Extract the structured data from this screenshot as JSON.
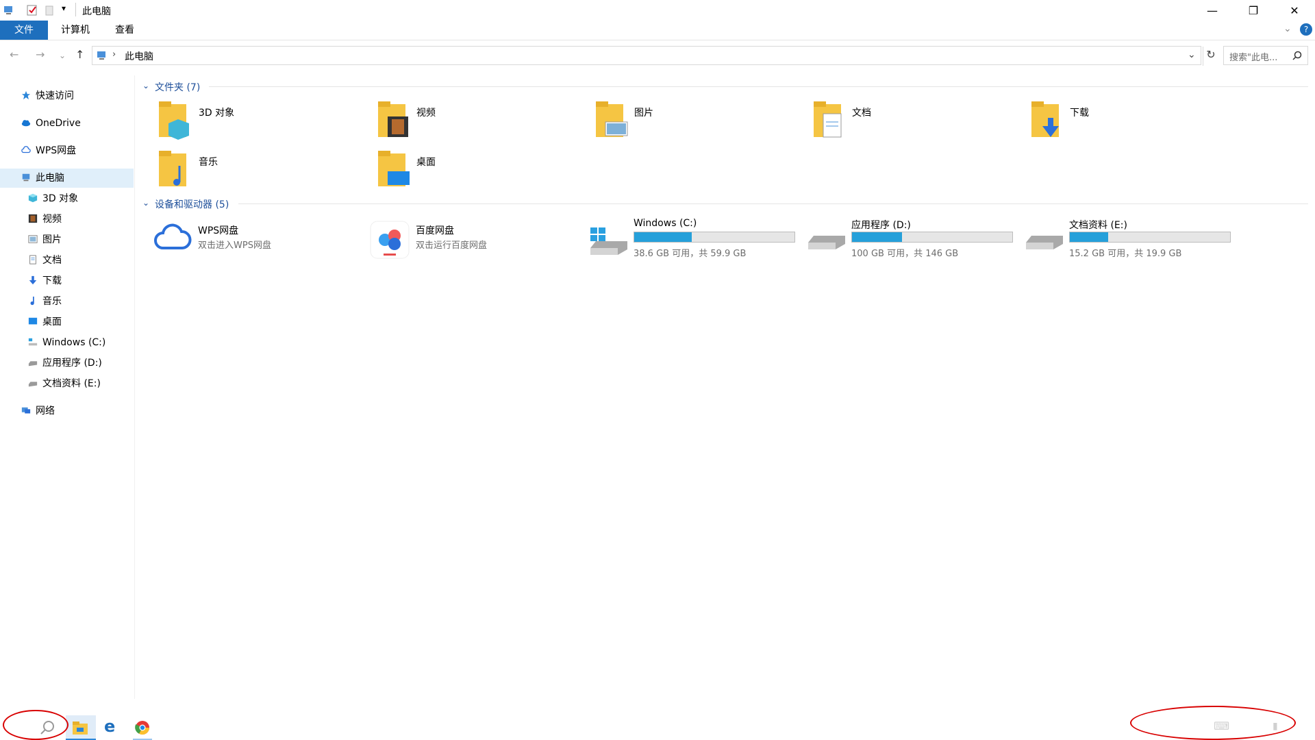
{
  "window": {
    "title": "此电脑"
  },
  "ribbon": {
    "tabs": [
      "文件",
      "计算机",
      "查看"
    ]
  },
  "address": {
    "path": "此电脑",
    "search_placeholder": "搜索\"此电..."
  },
  "sidebar": {
    "items": [
      {
        "label": "快速访问",
        "icon": "star-icon"
      },
      {
        "label": "OneDrive",
        "icon": "cloud-icon"
      },
      {
        "label": "WPS网盘",
        "icon": "cloud-outline-icon"
      },
      {
        "label": "此电脑",
        "icon": "computer-icon",
        "selected": true
      },
      {
        "label": "3D 对象",
        "icon": "cube-icon"
      },
      {
        "label": "视频",
        "icon": "film-icon"
      },
      {
        "label": "图片",
        "icon": "picture-icon"
      },
      {
        "label": "文档",
        "icon": "document-icon"
      },
      {
        "label": "下载",
        "icon": "download-icon"
      },
      {
        "label": "音乐",
        "icon": "music-icon"
      },
      {
        "label": "桌面",
        "icon": "desktop-icon"
      },
      {
        "label": "Windows (C:)",
        "icon": "windows-drive-icon"
      },
      {
        "label": "应用程序 (D:)",
        "icon": "drive-icon"
      },
      {
        "label": "文档资料 (E:)",
        "icon": "drive-icon"
      },
      {
        "label": "网络",
        "icon": "network-icon"
      }
    ]
  },
  "folders": {
    "header": "文件夹 (7)",
    "items": [
      {
        "label": "3D 对象",
        "icon": "3d-objects-folder-icon"
      },
      {
        "label": "视频",
        "icon": "videos-folder-icon"
      },
      {
        "label": "图片",
        "icon": "pictures-folder-icon"
      },
      {
        "label": "文档",
        "icon": "documents-folder-icon"
      },
      {
        "label": "下载",
        "icon": "downloads-folder-icon"
      },
      {
        "label": "音乐",
        "icon": "music-folder-icon"
      },
      {
        "label": "桌面",
        "icon": "desktop-folder-icon"
      }
    ]
  },
  "devices": {
    "header": "设备和驱动器 (5)",
    "items": [
      {
        "label": "WPS网盘",
        "sub": "双击进入WPS网盘",
        "icon": "wps-cloud-icon"
      },
      {
        "label": "百度网盘",
        "sub": "双击运行百度网盘",
        "icon": "baidu-netdisk-icon"
      },
      {
        "label": "Windows (C:)",
        "sub": "38.6 GB 可用，共 59.9 GB",
        "icon": "windows-drive-icon",
        "used_fraction": 0.36
      },
      {
        "label": "应用程序 (D:)",
        "sub": "100 GB 可用，共 146 GB",
        "icon": "drive-icon",
        "used_fraction": 0.31
      },
      {
        "label": "文档资料 (E:)",
        "sub": "15.2 GB 可用，共 19.9 GB",
        "icon": "drive-icon",
        "used_fraction": 0.24
      }
    ]
  },
  "taskbar": {
    "icons": [
      "search-icon",
      "file-explorer-icon",
      "edge-icon",
      "chrome-icon"
    ]
  },
  "colors": {
    "accent": "#1e6fbd",
    "bar_fill": "#26a0da",
    "highlight": "#cce4f7",
    "annotation": "#d80000"
  }
}
